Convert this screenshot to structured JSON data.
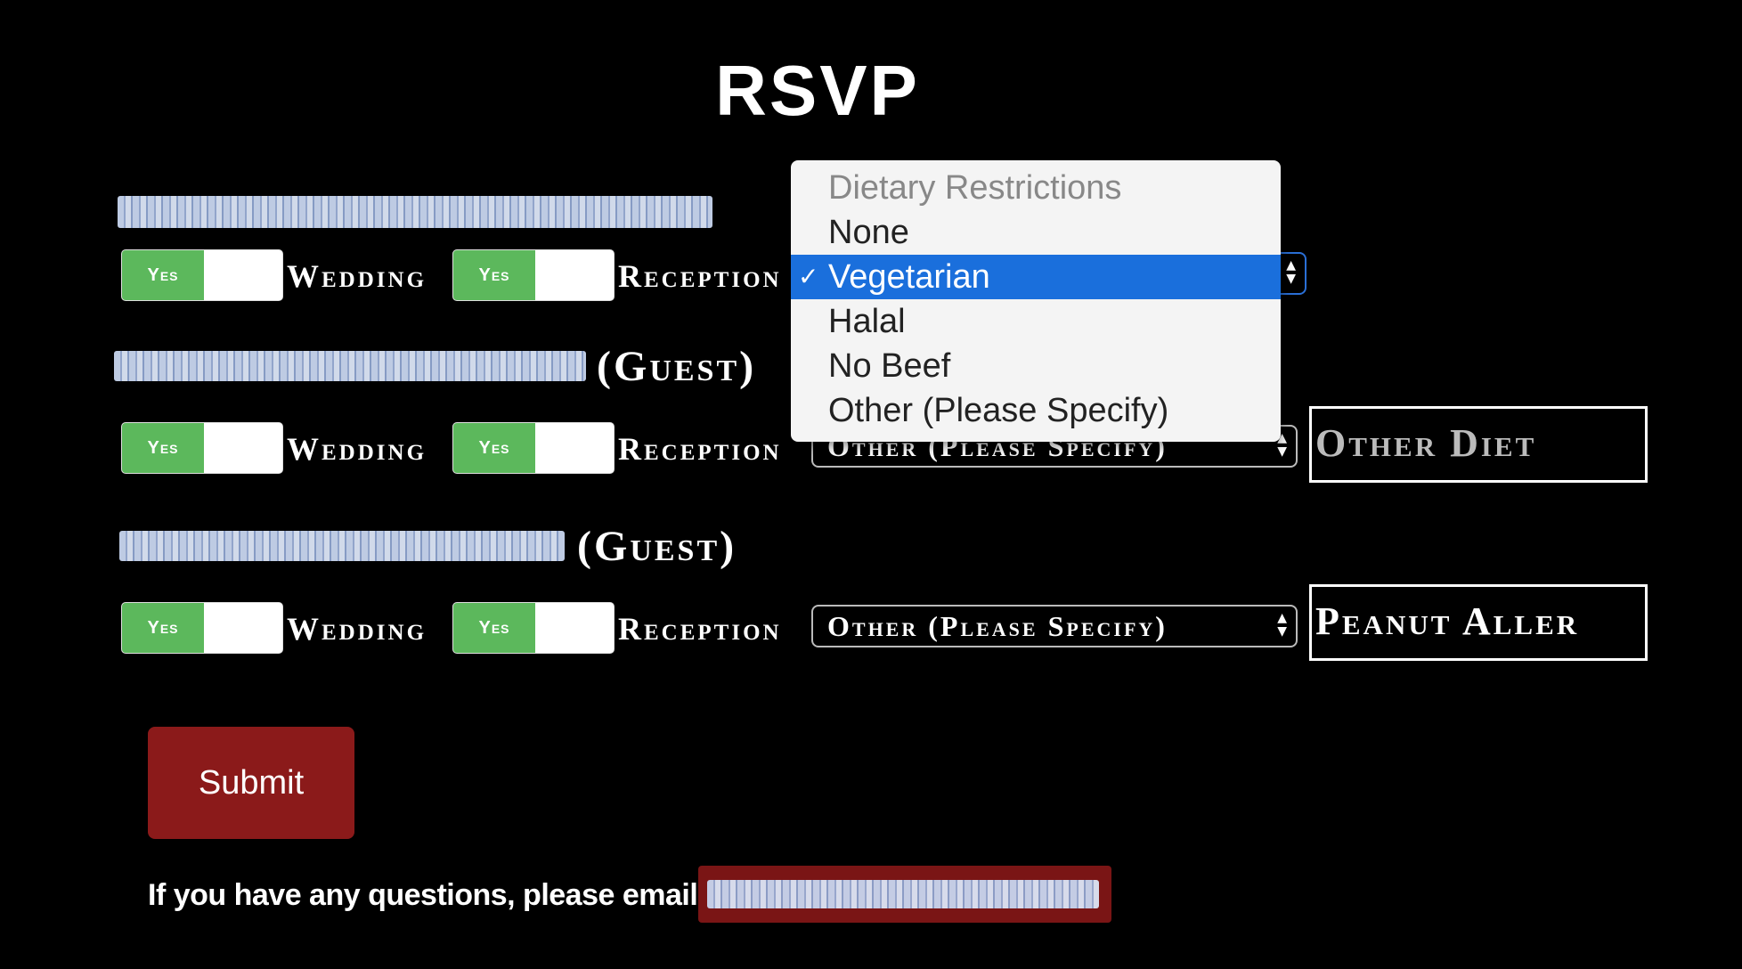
{
  "page": {
    "title": "RSVP"
  },
  "guests": [
    {
      "tag": "",
      "wedding_toggle": "Yes",
      "wedding_label": "Wedding",
      "reception_toggle": "Yes",
      "reception_label": "Reception",
      "diet_value": "",
      "other_diet": {
        "value": "",
        "placeholder": ""
      }
    },
    {
      "tag": "(Guest)",
      "wedding_toggle": "Yes",
      "wedding_label": "Wedding",
      "reception_toggle": "Yes",
      "reception_label": "Reception",
      "diet_value": "Other (Please Specify)",
      "other_diet": {
        "value": "",
        "placeholder": "Other Diet"
      }
    },
    {
      "tag": "(Guest)",
      "wedding_toggle": "Yes",
      "wedding_label": "Wedding",
      "reception_toggle": "Yes",
      "reception_label": "Reception",
      "diet_value": "Other (Please Specify)",
      "other_diet": {
        "value": "Peanut Aller",
        "placeholder": ""
      }
    }
  ],
  "diet_dropdown": {
    "options": [
      "Dietary Restrictions",
      "None",
      "Vegetarian",
      "Halal",
      "No Beef",
      "Other (Please Specify)"
    ],
    "selected": "Vegetarian",
    "selected_color": "#1a6fdc"
  },
  "submit": {
    "label": "Submit",
    "color": "#8b1a1a"
  },
  "footer": {
    "text": "If you have any questions, please email"
  },
  "colors": {
    "toggle_on": "#5cb85c",
    "background": "#000000"
  }
}
